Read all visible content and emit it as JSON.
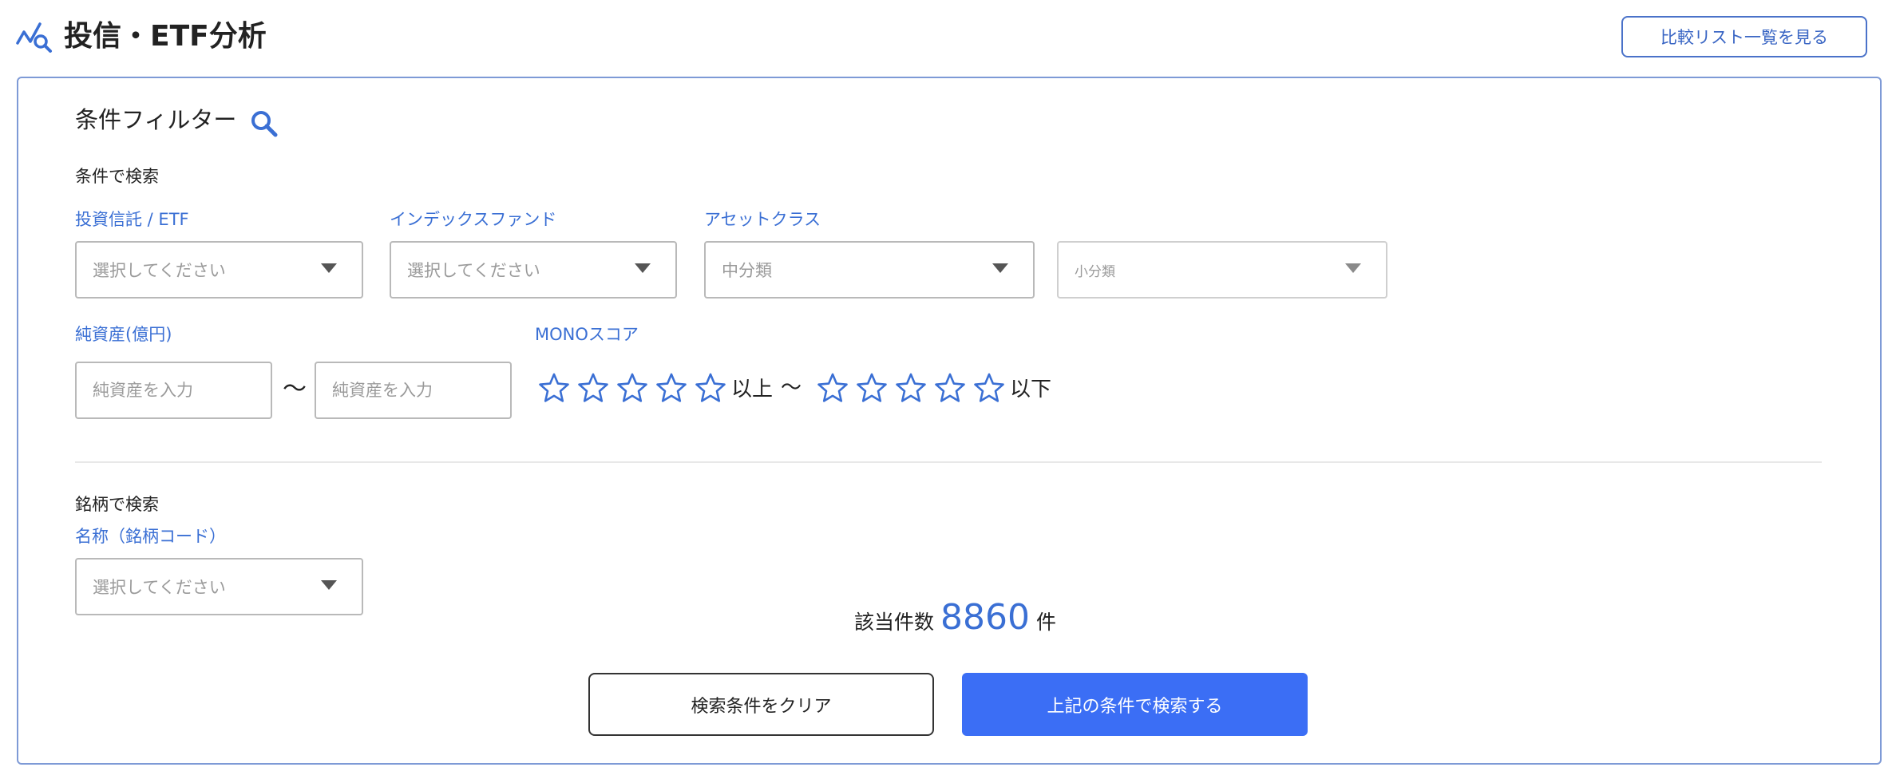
{
  "header": {
    "title": "投信・ETF分析",
    "compare_button": "比較リスト一覧を見る",
    "title_icon": "chart-search-icon"
  },
  "filter": {
    "title": "条件フィルター",
    "icon": "search-icon",
    "condition_section": "条件で検索",
    "fund_type": {
      "label": "投資信託 / ETF",
      "placeholder": "選択してください"
    },
    "index_fund": {
      "label": "インデックスファンド",
      "placeholder": "選択してください"
    },
    "asset_class": {
      "label": "アセットクラス",
      "middle": "中分類",
      "small": "小分類"
    },
    "net_assets": {
      "label": "純資産(億円)",
      "min_placeholder": "純資産を入力",
      "max_placeholder": "純資産を入力",
      "separator": "〜"
    },
    "mono_score": {
      "label": "MONOスコア",
      "min_suffix": "以上",
      "separator": "〜",
      "max_suffix": "以下",
      "min_stars_filled": 0,
      "max_stars_filled": 0,
      "star_count": 5
    },
    "name_section": "銘柄で検索",
    "name": {
      "label": "名称（銘柄コード）",
      "placeholder": "選択してください"
    }
  },
  "result": {
    "label": "該当件数",
    "count": "8860",
    "unit": "件"
  },
  "actions": {
    "clear": "検索条件をクリア",
    "search": "上記の条件で検索する"
  },
  "colors": {
    "accent": "#3a6fd4",
    "primary_button": "#3b6ef5",
    "panel_border": "#7e9ad6"
  }
}
